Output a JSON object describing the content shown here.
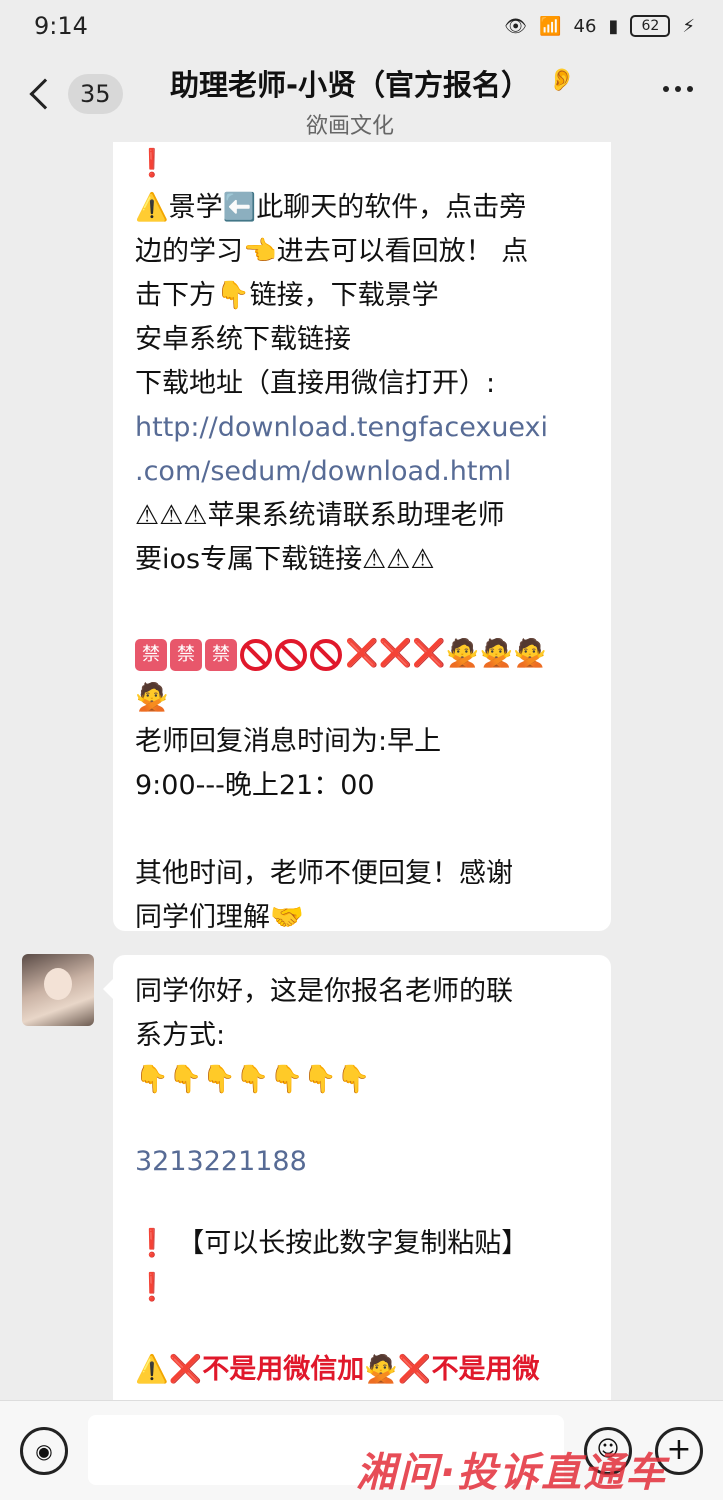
{
  "status_bar": {
    "time": "9:14",
    "network": "46",
    "battery": "62",
    "icons": [
      "eye-icon",
      "wifi-icon",
      "signal-icon",
      "battery-icon",
      "charging-icon"
    ]
  },
  "header": {
    "unread_count": "35",
    "title": "助理老师-小贤（官方报名）",
    "subtitle": "欲画文化"
  },
  "messages": {
    "msg1": {
      "lines": [
        "",
        "景学⬅️此聊天的软件，点击旁",
        "边的学习👈进去可以看回放！ 点",
        "击下方👇链接，下载景学",
        "安卓系统下载链接",
        "下载地址（直接用微信打开）:",
        "http://download.tengfacexuexi",
        ".com/sedum/download.html",
        "⚠⚠⚠苹果系统请联系助理老师",
        "要ios专属下载链接⚠⚠⚠",
        "",
        "",
        "🙅",
        "老师回复消息时间为:早上",
        "9:00---晚上21：00",
        "",
        "其他时间，老师不便回复！感谢",
        "同学们理解🤝"
      ],
      "ban_label": "禁",
      "x_mark": "❌"
    },
    "msg2": {
      "lines": [
        "同学你好，这是你报名老师的联",
        "系方式:",
        "👇👇👇👇👇👇👇",
        "",
        "3213221188",
        "",
        "【可以长按此数字复制粘贴】",
        "",
        "",
        "❌不是用微信加🙅❌不是用微"
      ]
    }
  },
  "input_bar": {
    "voice_icon": "voice-icon",
    "emoji_icon": "emoji-icon",
    "plus_icon": "plus-icon"
  },
  "watermark": "湘问·投诉直通车"
}
